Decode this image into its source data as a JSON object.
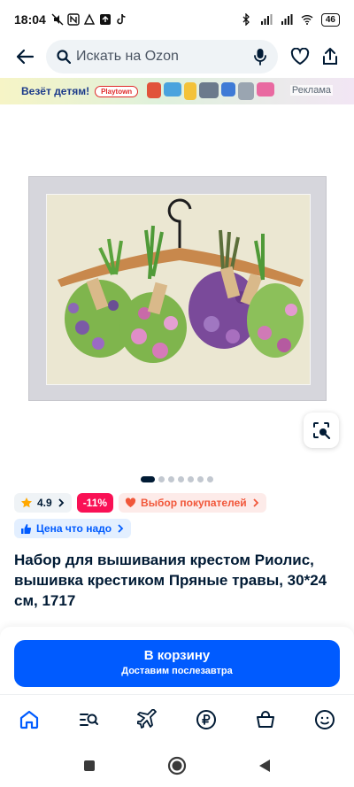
{
  "status_bar": {
    "time": "18:04",
    "battery": "46"
  },
  "search": {
    "placeholder": "Искать на Ozon"
  },
  "ad": {
    "text": "Везёт детям!",
    "brand": "Playtown",
    "label": "Реклама"
  },
  "gallery": {
    "image_count": 7,
    "active_index": 0
  },
  "badges": {
    "rating": "4.9",
    "discount": "-11%",
    "choice": "Выбор покупателей",
    "price": "Цена что надо"
  },
  "product": {
    "title": "Набор для вышивания крестом Риолис, вышивка крестиком Пряные травы, 30*24 см, 1717"
  },
  "cart": {
    "label": "В корзину",
    "delivery": "Доставим послезавтра"
  },
  "nav": {
    "items": [
      "home-icon",
      "catalog-icon",
      "travel-icon",
      "finance-icon",
      "cart-icon",
      "profile-icon"
    ]
  },
  "colors": {
    "accent": "#005bff",
    "discount": "#f91155",
    "choice": "#f1573a",
    "text": "#001a34"
  }
}
